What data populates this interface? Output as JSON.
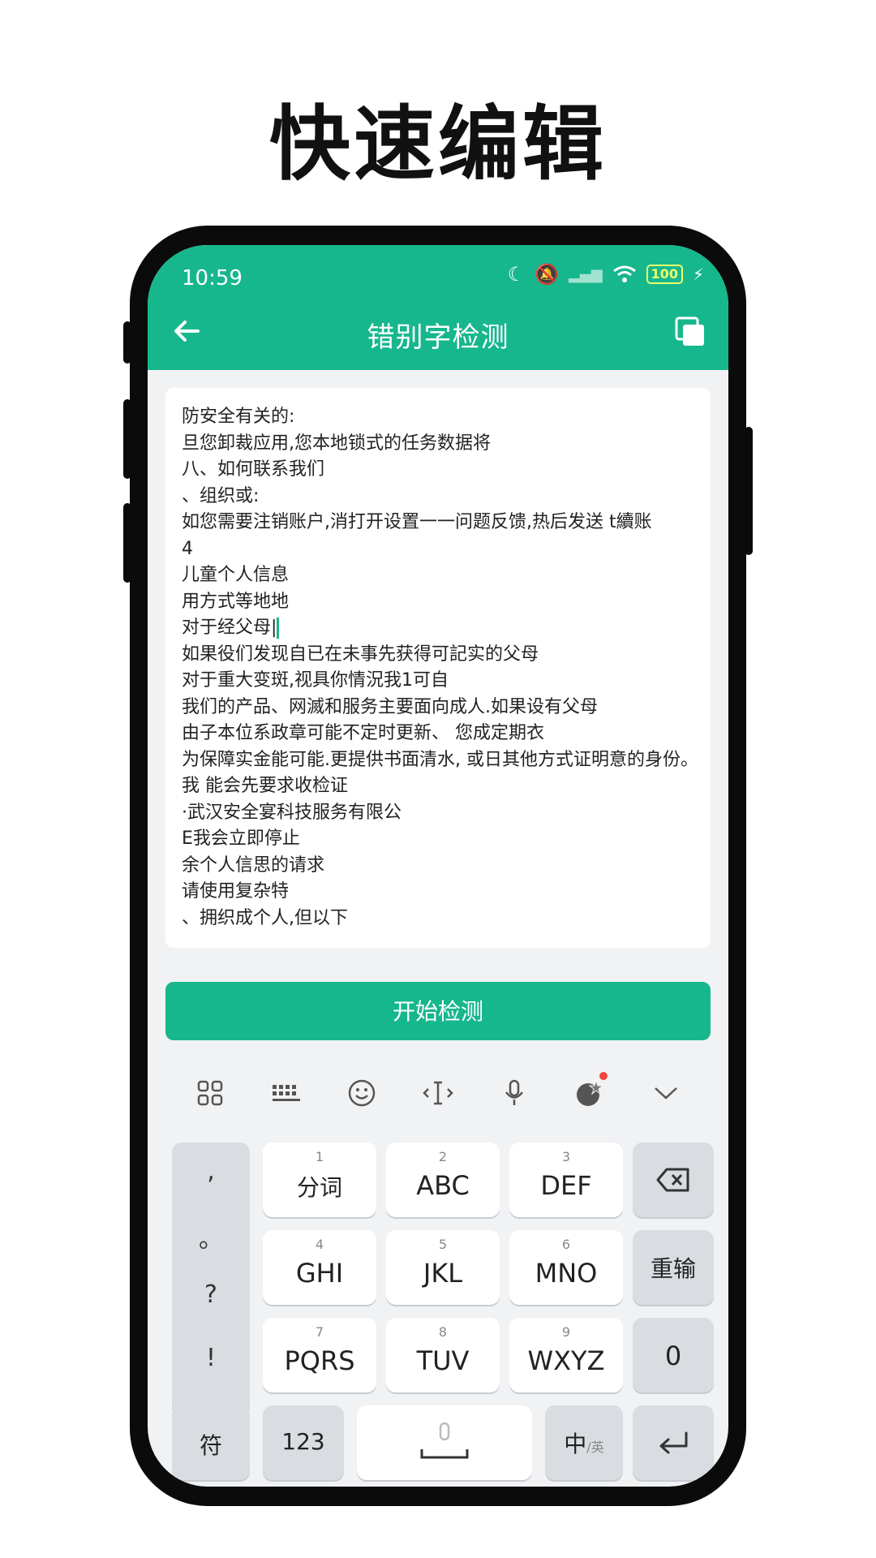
{
  "headline": "快速编辑",
  "status_bar": {
    "time": "10:59",
    "battery": "100"
  },
  "appbar": {
    "title": "错别字检测",
    "back_icon": "arrow-left-icon",
    "copy_icon": "copy-icon"
  },
  "editor": {
    "lines": [
      "防安全有关的:",
      "旦您卸裁应用,您本地锁式的任务数据将",
      "八、如何联系我们",
      "、组织或:",
      "如您需要注销账户,消打开设置一一问题反馈,热后发送 t續账",
      "4",
      "儿童个人信息",
      "用方式等地地",
      "对于经父母|",
      "如果役们发现自已在未事先获得可記实的父母",
      "对于重大变斑,视具你情況我1可自",
      "我们的产品、网滅和服务主要面向成人.如果设有父母",
      "由子本位系政章可能不定时更新、 您成定期衣",
      "为保障实金能可能.更提供书面清水, 或日其他方式证明意的身份。我 能会先要求收检证",
      "·武汉安全宴科技服务有限公",
      "E我会立即停止",
      "余个人信思的请求",
      "请使用复杂特",
      "、拥织成个人,但以下"
    ]
  },
  "start_button": "开始检测",
  "keyboard": {
    "toolbar_icons": [
      "grid-icon",
      "keyboard-icon",
      "emoji-icon",
      "cursor-icon",
      "mic-icon",
      "theme-icon",
      "collapse-icon"
    ],
    "punct": [
      ",",
      "。",
      "?",
      "!"
    ],
    "keys": [
      {
        "num": "1",
        "label": "分词"
      },
      {
        "num": "2",
        "label": "ABC"
      },
      {
        "num": "3",
        "label": "DEF"
      },
      {
        "num": "4",
        "label": "GHI"
      },
      {
        "num": "5",
        "label": "JKL"
      },
      {
        "num": "6",
        "label": "MNO"
      },
      {
        "num": "7",
        "label": "PQRS"
      },
      {
        "num": "8",
        "label": "TUV"
      },
      {
        "num": "9",
        "label": "WXYZ"
      }
    ],
    "reenter": "重输",
    "zero": "0",
    "symbol": "符",
    "num_mode": "123",
    "lang_main": "中",
    "lang_sub": "/英"
  }
}
